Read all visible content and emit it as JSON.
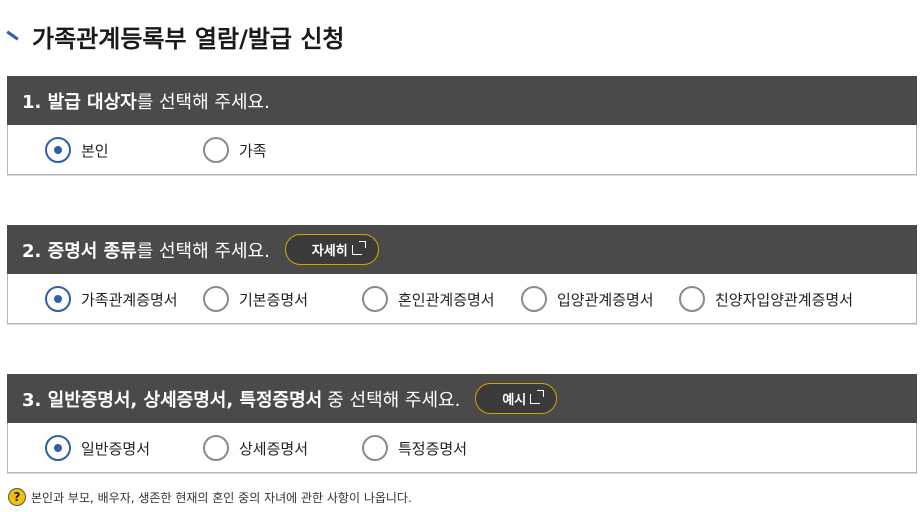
{
  "page": {
    "title": "가족관계등록부 열람/발급 신청"
  },
  "section1": {
    "heading_bold": "1. 발급 대상자",
    "heading_rest": "를 선택해 주세요.",
    "options": [
      "본인",
      "가족"
    ],
    "selected": "본인"
  },
  "section2": {
    "heading_bold": "2. 증명서 종류",
    "heading_rest": "를 선택해 주세요.",
    "detail_button": "자세히",
    "options": [
      "가족관계증명서",
      "기본증명서",
      "혼인관계증명서",
      "입양관계증명서",
      "친양자입양관계증명서"
    ],
    "selected": "가족관계증명서"
  },
  "section3": {
    "heading_bold": "3. 일반증명서, 상세증명서, 특정증명서",
    "heading_rest": "중 선택해 주세요.",
    "example_button": "예시",
    "options": [
      "일반증명서",
      "상세증명서",
      "특정증명서"
    ],
    "selected": "일반증명서"
  },
  "note": {
    "icon": "?",
    "text": "본인과 부모, 배우자, 생존한 현재의 혼인 중의 자녀에 관한 사항이 나옵니다."
  },
  "colors": {
    "header_bg": "#4a4a4a",
    "accent_blue": "#2f5fa8",
    "button_border": "#d4a500",
    "help_icon": "#f2c200"
  }
}
